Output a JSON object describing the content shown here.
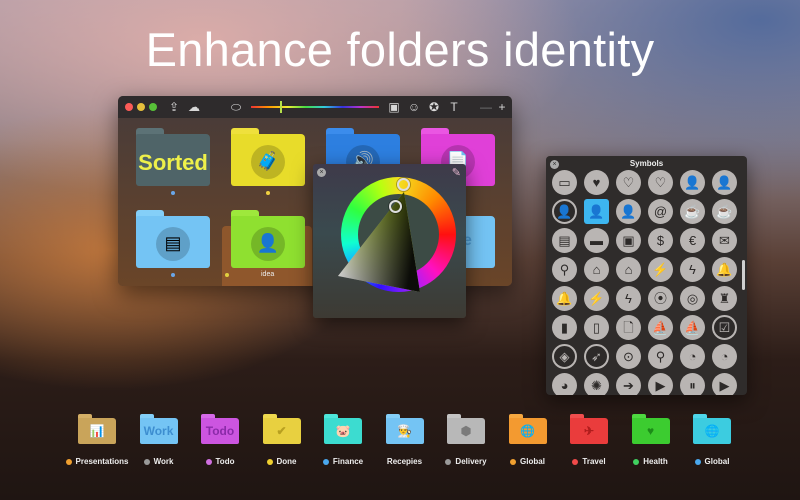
{
  "headline": "Enhance folders identity",
  "window": {
    "toolbar": {
      "icons": [
        "share-icon",
        "cloud-icon",
        "tag-icon",
        "hue-slider",
        "image-icon",
        "emoji-icon",
        "star-badge-icon",
        "text-icon",
        "minus-icon",
        "plus-icon"
      ],
      "glyphs": {
        "share": "⇪",
        "cloud": "☁",
        "tag": "⬭",
        "image": "▣",
        "emoji": "☺",
        "star": "✪",
        "text": "T",
        "minus": "—",
        "plus": "+"
      }
    },
    "folders": [
      {
        "name": "sorted",
        "label": "",
        "text": "Sorted",
        "color": "#4f6468",
        "tab": "#5c7276",
        "dot": "#6aa6e8",
        "emblem": ""
      },
      {
        "name": "travel",
        "label": "",
        "text": "",
        "color": "#e8dc2a",
        "tab": "#efe03c",
        "dot": "#f0d040",
        "emblem": "🧳"
      },
      {
        "name": "music",
        "label": "",
        "text": "",
        "color": "#2d7fe0",
        "tab": "#3b8cec",
        "dot": "",
        "emblem": "🔊"
      },
      {
        "name": "document",
        "label": "",
        "text": "",
        "color": "#e040d8",
        "tab": "#ea56e2",
        "dot": "",
        "emblem": "📄"
      },
      {
        "name": "notes",
        "label": "",
        "text": "",
        "color": "#74c4f4",
        "tab": "#84cff8",
        "dot": "#6aa6e8",
        "emblem": "▤"
      },
      {
        "name": "idea",
        "label": "idea",
        "text": "",
        "color": "#8fe030",
        "tab": "#9ee83c",
        "dot": "#e0d040",
        "emblem": "👤"
      },
      {
        "name": "more",
        "label": "",
        "text": "ore",
        "color": "#74c4f4",
        "tab": "#84cff8",
        "dot": "",
        "emblem": ""
      }
    ]
  },
  "color_picker": {
    "close_glyph": "×",
    "eyedropper_glyph": "✎",
    "selected_hue": "yellow-green"
  },
  "symbols": {
    "title": "Symbols",
    "close_glyph": "×",
    "items": [
      {
        "name": "inbox",
        "g": "▭"
      },
      {
        "name": "heart-filled",
        "g": "♥"
      },
      {
        "name": "heart-outline",
        "g": "♡"
      },
      {
        "name": "heart-pulse",
        "g": "♡"
      },
      {
        "name": "person-filled",
        "g": "👤"
      },
      {
        "name": "person-outline",
        "g": "👤"
      },
      {
        "name": "person-circle",
        "g": "👤",
        "style": "outl"
      },
      {
        "name": "idea-person",
        "g": "👤",
        "style": "sel"
      },
      {
        "name": "idea-person-outline",
        "g": "👤"
      },
      {
        "name": "at-sign",
        "g": "@"
      },
      {
        "name": "teapot-outline",
        "g": "☕"
      },
      {
        "name": "teapot-filled",
        "g": "☕"
      },
      {
        "name": "printer",
        "g": "▤"
      },
      {
        "name": "battery",
        "g": "▬"
      },
      {
        "name": "suitcase",
        "g": "▣"
      },
      {
        "name": "dollar-bill",
        "g": "$"
      },
      {
        "name": "euro-bill",
        "g": "€"
      },
      {
        "name": "envelope",
        "g": "✉"
      },
      {
        "name": "magnifier",
        "g": "⚲"
      },
      {
        "name": "home-filled",
        "g": "⌂"
      },
      {
        "name": "home-outline",
        "g": "⌂"
      },
      {
        "name": "bolt-filled",
        "g": "⚡"
      },
      {
        "name": "bolt-outline",
        "g": "ϟ"
      },
      {
        "name": "bell-filled",
        "g": "🔔"
      },
      {
        "name": "bell-outline",
        "g": "🔔"
      },
      {
        "name": "bolt-filled-2",
        "g": "⚡"
      },
      {
        "name": "bolt-outline-2",
        "g": "ϟ"
      },
      {
        "name": "rings-filled",
        "g": "⦿"
      },
      {
        "name": "rings-outline",
        "g": "◎"
      },
      {
        "name": "chef-hat",
        "g": "♜"
      },
      {
        "name": "tag-filled",
        "g": "▮"
      },
      {
        "name": "tag-outline",
        "g": "▯"
      },
      {
        "name": "file",
        "g": "🗋"
      },
      {
        "name": "sailboat-filled",
        "g": "⛵"
      },
      {
        "name": "sailboat-outline",
        "g": "⛵"
      },
      {
        "name": "doc-check",
        "g": "☑",
        "style": "outl"
      },
      {
        "name": "price-tag",
        "g": "◈",
        "style": "outl"
      },
      {
        "name": "rocket",
        "g": "➶",
        "style": "outl"
      },
      {
        "name": "map-pin-filled",
        "g": "⊙"
      },
      {
        "name": "map-pin-outline",
        "g": "⚲"
      },
      {
        "name": "pie-chart-filled",
        "g": "◔"
      },
      {
        "name": "pie-chart-outline",
        "g": "◔"
      },
      {
        "name": "pie-chart-2",
        "g": "◕"
      },
      {
        "name": "aperture",
        "g": "✺"
      },
      {
        "name": "arrow-right-circle",
        "g": "➔"
      },
      {
        "name": "play-circle",
        "g": "▶"
      },
      {
        "name": "pause-circle",
        "g": "⏸"
      },
      {
        "name": "play",
        "g": "▶"
      }
    ]
  },
  "bottom_folders": [
    {
      "label": "Presentations",
      "dot": "#f0a030",
      "color": "#c9a45a",
      "tab": "#d4af66",
      "text": "",
      "emblem": "📊",
      "ink": "#a88440"
    },
    {
      "label": "Work",
      "dot": "#9a9a9a",
      "color": "#74c4f4",
      "tab": "#84cff8",
      "text": "Work",
      "emblem": "",
      "ink": "#3d8ed0"
    },
    {
      "label": "Todo",
      "dot": "#d070e0",
      "color": "#cc55e0",
      "tab": "#d66ae8",
      "text": "Todo",
      "emblem": "",
      "ink": "#8a2aa8"
    },
    {
      "label": "Done",
      "dot": "#f0d030",
      "color": "#e8d040",
      "tab": "#eed84e",
      "text": "",
      "emblem": "✔",
      "ink": "#b8a020"
    },
    {
      "label": "Finance",
      "dot": "#4aa8ee",
      "color": "#3cdcd0",
      "tab": "#4ee6da",
      "text": "",
      "emblem": "🐷",
      "ink": "#1ea898"
    },
    {
      "label": "Recepies",
      "dot": "",
      "color": "#74c4f4",
      "tab": "#84cff8",
      "text": "",
      "emblem": "👨‍🍳",
      "ink": "#3d8ed0"
    },
    {
      "label": "Delivery",
      "dot": "#9a9a9a",
      "color": "#b8b8b8",
      "tab": "#c4c4c4",
      "text": "",
      "emblem": "⬢",
      "ink": "#7a7a7a"
    },
    {
      "label": "Global",
      "dot": "#f0a030",
      "color": "#f39a30",
      "tab": "#f6a840",
      "text": "",
      "emblem": "🌐",
      "ink": "#c06c10"
    },
    {
      "label": "Travel",
      "dot": "#f04a4a",
      "color": "#ea3c3c",
      "tab": "#f04e4e",
      "text": "",
      "emblem": "✈",
      "ink": "#b01c1c"
    },
    {
      "label": "Health",
      "dot": "#40d060",
      "color": "#3ccc30",
      "tab": "#4ed840",
      "text": "",
      "emblem": "♥",
      "ink": "#1c8c18"
    },
    {
      "label": "Global",
      "dot": "#4aa8ee",
      "color": "#3ccce0",
      "tab": "#4ed6ea",
      "text": "",
      "emblem": "🌐",
      "ink": "#1a8aa0"
    }
  ]
}
